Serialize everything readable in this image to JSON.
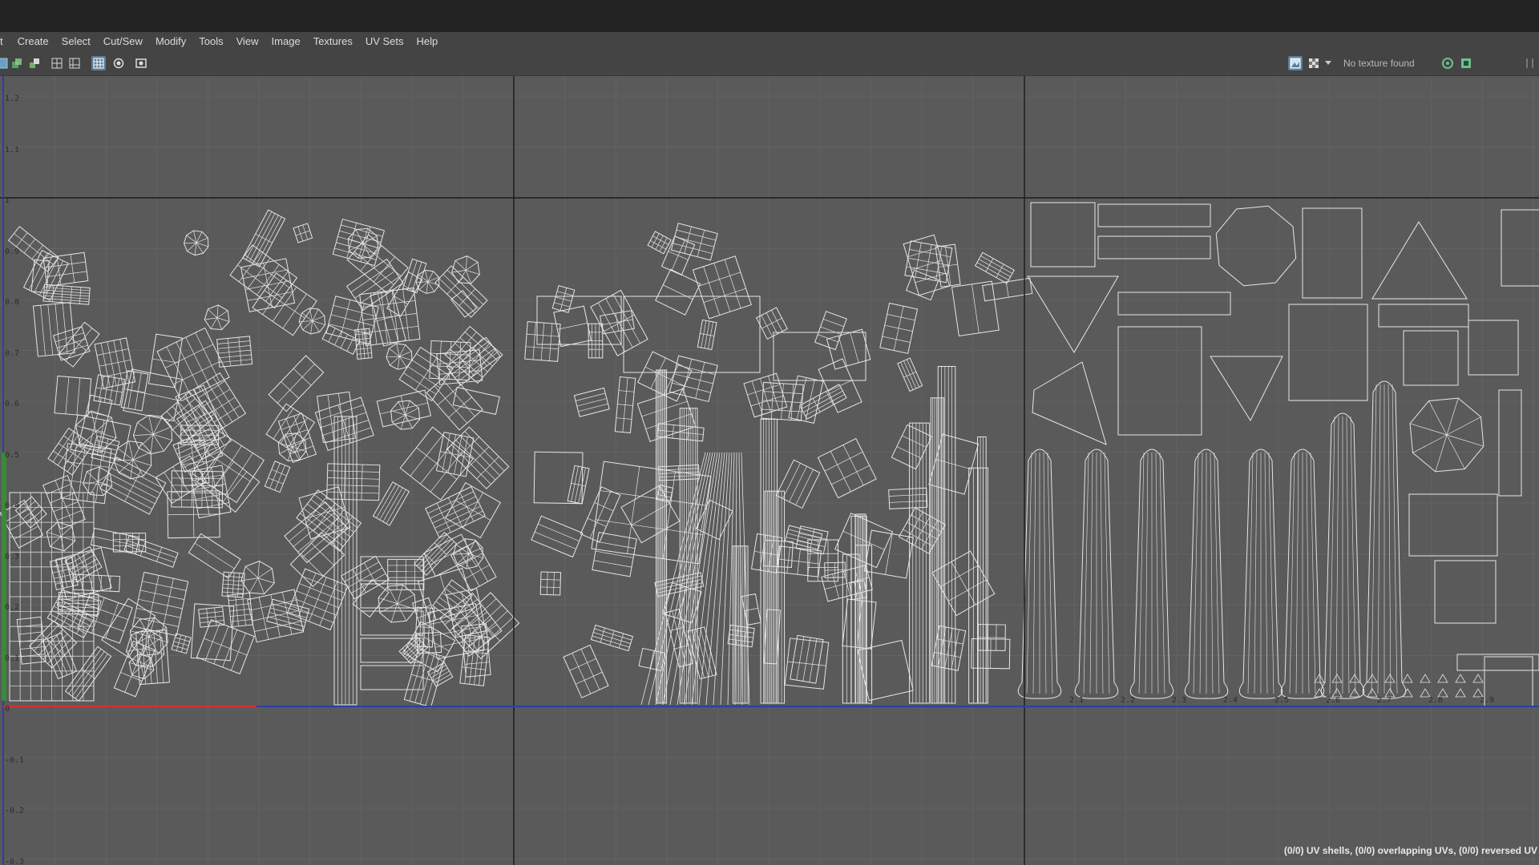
{
  "window": {
    "title": ""
  },
  "menu": [
    {
      "label": "t"
    },
    {
      "label": "Create"
    },
    {
      "label": "Select"
    },
    {
      "label": "Cut/Sew"
    },
    {
      "label": "Modify"
    },
    {
      "label": "Tools"
    },
    {
      "label": "View"
    },
    {
      "label": "Image"
    },
    {
      "label": "Textures"
    },
    {
      "label": "UV Sets"
    },
    {
      "label": "Help"
    }
  ],
  "toolbar": {
    "left_icons": [
      "uv-tile-icon",
      "shaded-uv-icon",
      "distortion-icon",
      "grid-icon",
      "pixel-snap-icon",
      "display-grid-icon",
      "filter-icon",
      "screenshot-icon"
    ],
    "right_icons": [
      "display-image-icon",
      "checker-icon",
      "dropdown-icon",
      "refresh-texture-icon",
      "image-settings-icon"
    ],
    "texture_status": "No texture found"
  },
  "viewport": {
    "v_axis_labels": [
      "1.2",
      "1.1",
      "1",
      "0.9",
      "0.8",
      "0.7",
      "0.6",
      "0.5",
      "0.4",
      "0.3",
      "0.2",
      "0.1",
      "0",
      "-0.1",
      "-0.2",
      "-0.3"
    ],
    "u_tick_labels": [
      "2.1",
      "2.2",
      "2.3",
      "2.4",
      "2.5",
      "2.6",
      "2.7",
      "2.8",
      "2.9"
    ],
    "colors": {
      "background": "#5a5a5a",
      "grid_minor": "#636363",
      "tile_border": "#1c1c1c",
      "wireframe": "#e6e6e6",
      "u_axis": "#d23030",
      "v_axis": "#2a3ea8",
      "selection_marker": "#3a8a3a"
    }
  },
  "status": {
    "summary": "(0/0) UV shells, (0/0) overlapping UVs, (0/0) reversed UV"
  }
}
